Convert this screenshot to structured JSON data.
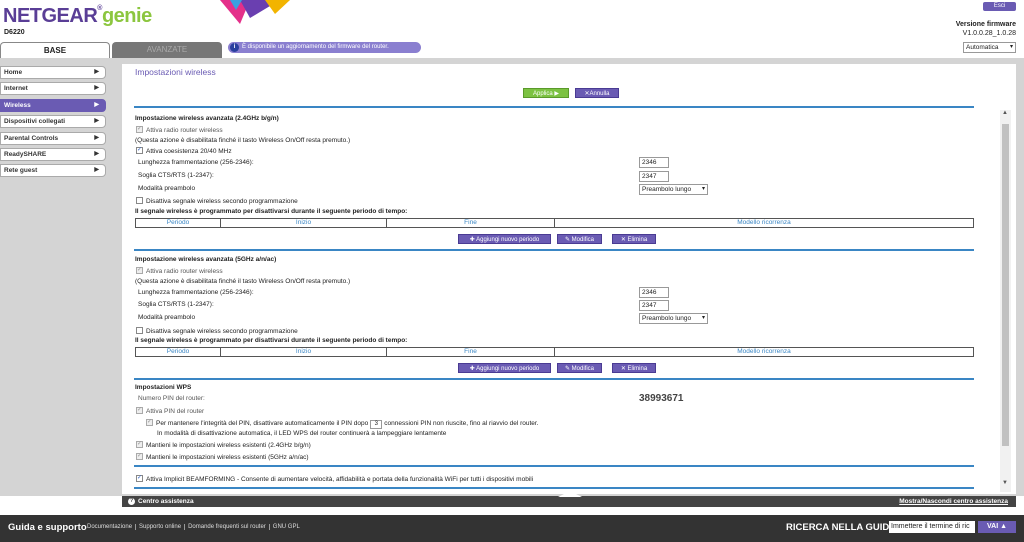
{
  "header": {
    "logo_main": "NETGEAR",
    "logo_reg": "®",
    "logo_genie": "genie",
    "model": "D6220",
    "logout_label": "Esci",
    "firmware_title": "Versione firmware",
    "firmware_version": "V1.0.0.28_1.0.28",
    "language_select": "Automatica",
    "tab_base": "BASE",
    "tab_advanced": "AVANZATE",
    "notice_icon": "i",
    "notice": "È disponibile un aggiornamento del firmware del router."
  },
  "nav": {
    "items": [
      {
        "label": "Home"
      },
      {
        "label": "Internet"
      },
      {
        "label": "Wireless"
      },
      {
        "label": "Dispositivi collegati"
      },
      {
        "label": "Parental Controls"
      },
      {
        "label": "ReadySHARE"
      },
      {
        "label": "Rete guest"
      }
    ],
    "active": "Wireless"
  },
  "panel": {
    "title": "Impostazioni wireless",
    "apply_label": "Applica ▶",
    "cancel_label": "✕Annulla"
  },
  "band24": {
    "title": "Impostazione wireless avanzata (2.4GHz b/g/n)",
    "enable_radio": "Attiva radio router wireless",
    "radio_note": "(Questa azione è disabilitata finché il tasto Wireless On/Off resta premuto.)",
    "coexistence": "Attiva coesistenza 20/40 MHz",
    "frag_label": "Lunghezza frammentazione (256-2346):",
    "frag_value": "2346",
    "cts_label": "Soglia CTS/RTS (1-2347):",
    "cts_value": "2347",
    "preamble_label": "Modalità preambolo",
    "preamble_value": "Preambolo lungo",
    "schedule_disable": "Disattiva segnale wireless secondo programmazione",
    "schedule_note": "Il segnale wireless è programmato per disattivarsi durante il seguente periodo di tempo:",
    "col_period": "Periodo",
    "col_start": "Inizio",
    "col_end": "Fine",
    "col_recurrence": "Modello ricorrenza",
    "add_label": "✚ Aggiungi nuovo periodo",
    "edit_label": "✎ Modifica",
    "delete_label": "✕ Elimina"
  },
  "band5": {
    "title": "Impostazione wireless avanzata (5GHz a/n/ac)",
    "enable_radio": "Attiva radio router wireless",
    "radio_note": "(Questa azione è disabilitata finché il tasto Wireless On/Off resta premuto.)",
    "frag_label": "Lunghezza frammentazione (256-2346):",
    "frag_value": "2346",
    "cts_label": "Soglia CTS/RTS (1-2347):",
    "cts_value": "2347",
    "preamble_label": "Modalità preambolo",
    "preamble_value": "Preambolo lungo",
    "schedule_disable": "Disattiva segnale wireless secondo programmazione",
    "schedule_note": "Il segnale wireless è programmato per disattivarsi durante il seguente periodo di tempo:",
    "col_period": "Periodo",
    "col_start": "Inizio",
    "col_end": "Fine",
    "col_recurrence": "Modello ricorrenza",
    "add_label": "✚ Aggiungi nuovo periodo",
    "edit_label": "✎ Modifica",
    "delete_label": "✕ Elimina"
  },
  "wps": {
    "title": "Impostazioni WPS",
    "pin_label": "Numero PIN del router:",
    "pin_value": "38993671",
    "enable_pin": "Attiva PIN del router",
    "pin_protect_pre": "Per mantenere l'integrità del PIN, disattivare automaticamente il PIN dopo",
    "pin_attempts": "3",
    "pin_protect_post": "connessioni PIN non riuscite, fino al riavvio del router.",
    "pin_protect_note": "In modalità di disattivazione automatica, il LED WPS del router continuerà a lampeggiare lentamente",
    "keep24": "Mantieni le impostazioni wireless esistenti (2.4GHz b/g/n)",
    "keep5": "Mantieni le impostazioni wireless esistenti (5GHz a/n/ac)"
  },
  "beamforming": {
    "label": "Attiva Implicit BEAMFORMING - Consente di aumentare velocità, affidabilità e portata della funzionalità WiFi per tutti i dispositivi mobili"
  },
  "helpbar": {
    "icon": "?",
    "label": "Centro assistenza",
    "toggle": "Mostra/Nascondi centro assistenza"
  },
  "footer": {
    "title": "Guida e supporto",
    "links": [
      "Documentazione",
      "Supporto online",
      "Domande frequenti sul router",
      "GNU GPL"
    ],
    "search_label": "RICERCA NELLA GUIDA",
    "search_placeholder": "Immettere il termine di ric",
    "search_button": "VAI ▲"
  },
  "colors": {
    "accent": "#6a5bb3",
    "apply_green": "#7cc242",
    "rule_blue": "#3a86c4",
    "frame_grey": "#d4d4d4"
  }
}
